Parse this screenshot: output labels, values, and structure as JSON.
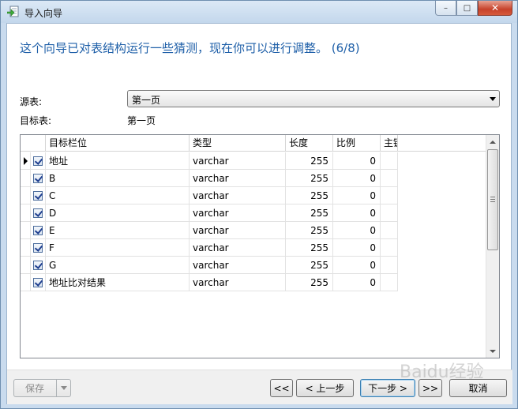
{
  "window": {
    "title": "导入向导",
    "minimize_glyph": "–",
    "maximize_glyph": "□",
    "close_glyph": "✕"
  },
  "heading": "这个向导已对表结构运行一些猜测，现在你可以进行调整。 (6/8)",
  "source_table": {
    "label": "源表:",
    "value": "第一页"
  },
  "target_table": {
    "label": "目标表:",
    "value": "第一页"
  },
  "grid": {
    "columns": [
      "目标栏位",
      "类型",
      "长度",
      "比例",
      "主键"
    ],
    "rows": [
      {
        "field": "地址",
        "type": "varchar",
        "length": "255",
        "scale": "0",
        "checked": true,
        "current": true
      },
      {
        "field": "B",
        "type": "varchar",
        "length": "255",
        "scale": "0",
        "checked": true,
        "current": false
      },
      {
        "field": "C",
        "type": "varchar",
        "length": "255",
        "scale": "0",
        "checked": true,
        "current": false
      },
      {
        "field": "D",
        "type": "varchar",
        "length": "255",
        "scale": "0",
        "checked": true,
        "current": false
      },
      {
        "field": "E",
        "type": "varchar",
        "length": "255",
        "scale": "0",
        "checked": true,
        "current": false
      },
      {
        "field": "F",
        "type": "varchar",
        "length": "255",
        "scale": "0",
        "checked": true,
        "current": false
      },
      {
        "field": "G",
        "type": "varchar",
        "length": "255",
        "scale": "0",
        "checked": true,
        "current": false
      },
      {
        "field": "地址比对结果",
        "type": "varchar",
        "length": "255",
        "scale": "0",
        "checked": true,
        "current": false
      }
    ]
  },
  "buttons": {
    "save": "保存",
    "first": "<<",
    "prev": "< 上一步",
    "next": "下一步 >",
    "last": ">>",
    "cancel": "取消"
  },
  "watermark": "Baidu经验"
}
